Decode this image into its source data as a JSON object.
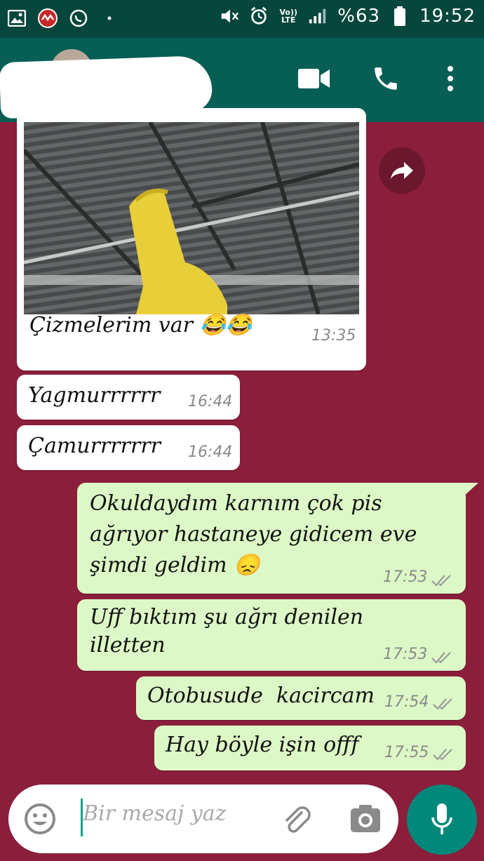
{
  "status_bar": {
    "battery_percent": "%63",
    "clock": "19:52",
    "network_label_top": "Vo))",
    "network_label_bottom": "LTE"
  },
  "header": {
    "contact_name": "",
    "icons": [
      "video-call-icon",
      "phone-icon",
      "more-vert-icon"
    ]
  },
  "messages": [
    {
      "direction": "in",
      "type": "image",
      "caption": "Çizmelerim var 😂😂",
      "time": "13:35"
    },
    {
      "direction": "in",
      "text": "Yagmurrrrrr",
      "time": "16:44"
    },
    {
      "direction": "in",
      "text": "Çamurrrrrrr",
      "time": "16:44"
    },
    {
      "direction": "out",
      "lines": [
        "Okuldaydım karnım çok pis",
        "ağrıyor hastaneye gidicem eve",
        "şimdi geldim 😞"
      ],
      "time": "17:53",
      "status": "read"
    },
    {
      "direction": "out",
      "lines": [
        "Uff bıktım şu ağrı denilen",
        "illetten"
      ],
      "time": "17:53",
      "status": "read"
    },
    {
      "direction": "out",
      "text": "Otobusude  kacircam",
      "time": "17:54",
      "status": "read"
    },
    {
      "direction": "out",
      "text": "Hay böyle işin offf",
      "time": "17:55",
      "status": "read"
    }
  ],
  "composer": {
    "placeholder": "Bir mesaj yaz"
  },
  "colors": {
    "header": "#075e54",
    "status_bar": "#07463c",
    "wallpaper": "#8a1e3b",
    "outgoing_bubble": "#dcf8c6",
    "incoming_bubble": "#ffffff",
    "mic_button": "#00897b"
  }
}
